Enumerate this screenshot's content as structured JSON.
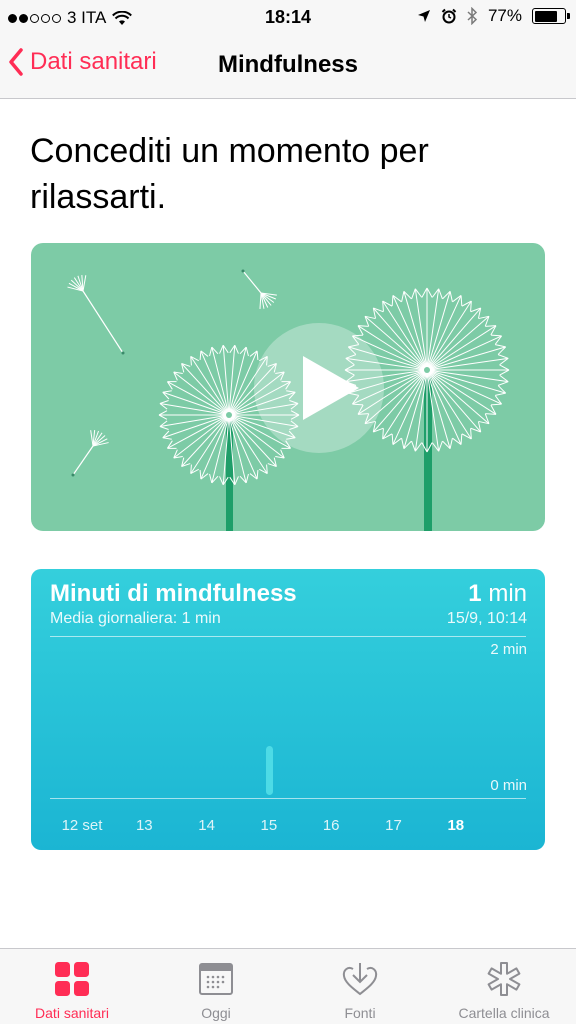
{
  "status_bar": {
    "carrier": "3 ITA",
    "time": "18:14",
    "battery": "77%",
    "signal_dots": [
      true,
      true,
      false,
      false,
      false
    ],
    "battery_fill": 0.77
  },
  "nav": {
    "back_label": "Dati sanitari",
    "title": "Mindfulness"
  },
  "headline": "Concediti un momento per rilassarti.",
  "video": {
    "background_color": "#7dcba6"
  },
  "chart": {
    "title": "Minuti di mindfulness",
    "value_number": "1",
    "value_unit": "min",
    "subtitle": "Media giornaliera: 1 min",
    "date": "15/9, 10:14",
    "y_top_label": "2 min",
    "y_bottom_label": "0 min"
  },
  "chart_data": {
    "type": "bar",
    "title": "Minuti di mindfulness",
    "categories": [
      "12 set",
      "13",
      "14",
      "15",
      "16",
      "17",
      "18"
    ],
    "values": [
      0,
      0,
      0,
      1,
      0,
      0,
      0
    ],
    "ylim": [
      0,
      2
    ],
    "current_category": "18"
  },
  "tabs": [
    {
      "label": "Dati sanitari",
      "icon": "dashboard-grid-icon",
      "active": true
    },
    {
      "label": "Oggi",
      "icon": "calendar-icon",
      "active": false
    },
    {
      "label": "Fonti",
      "icon": "download-heart-icon",
      "active": false
    },
    {
      "label": "Cartella clinica",
      "icon": "medical-star-icon",
      "active": false
    }
  ],
  "colors": {
    "accent": "#ff2d55",
    "chart_top": "#34cfdc",
    "chart_bottom": "#1bb5d3",
    "bar": "#4ddbe6",
    "tab_inactive": "#8e8e93"
  }
}
